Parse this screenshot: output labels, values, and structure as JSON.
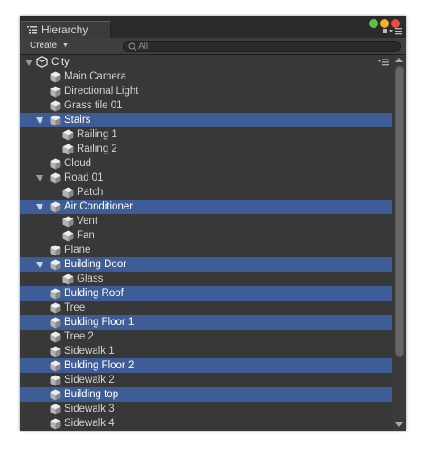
{
  "window": {
    "tab_label": "Hierarchy",
    "close_color": "#ec4b3f",
    "minimize_color": "#f3b12c",
    "maximize_color": "#5bc24b"
  },
  "toolbar": {
    "create_label": "Create",
    "search_placeholder": "All",
    "search_value": ""
  },
  "scene": {
    "name": "City"
  },
  "colors": {
    "selection": "#3e5d96",
    "panel": "#383838"
  },
  "items": [
    {
      "label": "Main Camera",
      "depth": 1,
      "expandable": false,
      "selected": false
    },
    {
      "label": "Directional Light",
      "depth": 1,
      "expandable": false,
      "selected": false
    },
    {
      "label": "Grass tile 01",
      "depth": 1,
      "expandable": false,
      "selected": false
    },
    {
      "label": "Stairs",
      "depth": 1,
      "expandable": true,
      "selected": true
    },
    {
      "label": "Railing 1",
      "depth": 2,
      "expandable": false,
      "selected": false
    },
    {
      "label": "Railing 2",
      "depth": 2,
      "expandable": false,
      "selected": false
    },
    {
      "label": "Cloud",
      "depth": 1,
      "expandable": false,
      "selected": false
    },
    {
      "label": "Road 01",
      "depth": 1,
      "expandable": true,
      "selected": false
    },
    {
      "label": "Patch",
      "depth": 2,
      "expandable": false,
      "selected": false
    },
    {
      "label": "Air Conditioner",
      "depth": 1,
      "expandable": true,
      "selected": true
    },
    {
      "label": "Vent",
      "depth": 2,
      "expandable": false,
      "selected": false
    },
    {
      "label": "Fan",
      "depth": 2,
      "expandable": false,
      "selected": false
    },
    {
      "label": "Plane",
      "depth": 1,
      "expandable": false,
      "selected": false
    },
    {
      "label": "Building Door",
      "depth": 1,
      "expandable": true,
      "selected": true
    },
    {
      "label": "Glass",
      "depth": 2,
      "expandable": false,
      "selected": false
    },
    {
      "label": "Bulding Roof",
      "depth": 1,
      "expandable": false,
      "selected": true
    },
    {
      "label": "Tree",
      "depth": 1,
      "expandable": false,
      "selected": false
    },
    {
      "label": "Bulding Floor 1",
      "depth": 1,
      "expandable": false,
      "selected": true
    },
    {
      "label": "Tree 2",
      "depth": 1,
      "expandable": false,
      "selected": false
    },
    {
      "label": "Sidewalk 1",
      "depth": 1,
      "expandable": false,
      "selected": false
    },
    {
      "label": "Bulding Floor 2",
      "depth": 1,
      "expandable": false,
      "selected": true
    },
    {
      "label": "Sidewalk 2",
      "depth": 1,
      "expandable": false,
      "selected": false
    },
    {
      "label": "Building top",
      "depth": 1,
      "expandable": false,
      "selected": true
    },
    {
      "label": "Sidewalk 3",
      "depth": 1,
      "expandable": false,
      "selected": false
    },
    {
      "label": "Sidewalk 4",
      "depth": 1,
      "expandable": false,
      "selected": false
    }
  ]
}
